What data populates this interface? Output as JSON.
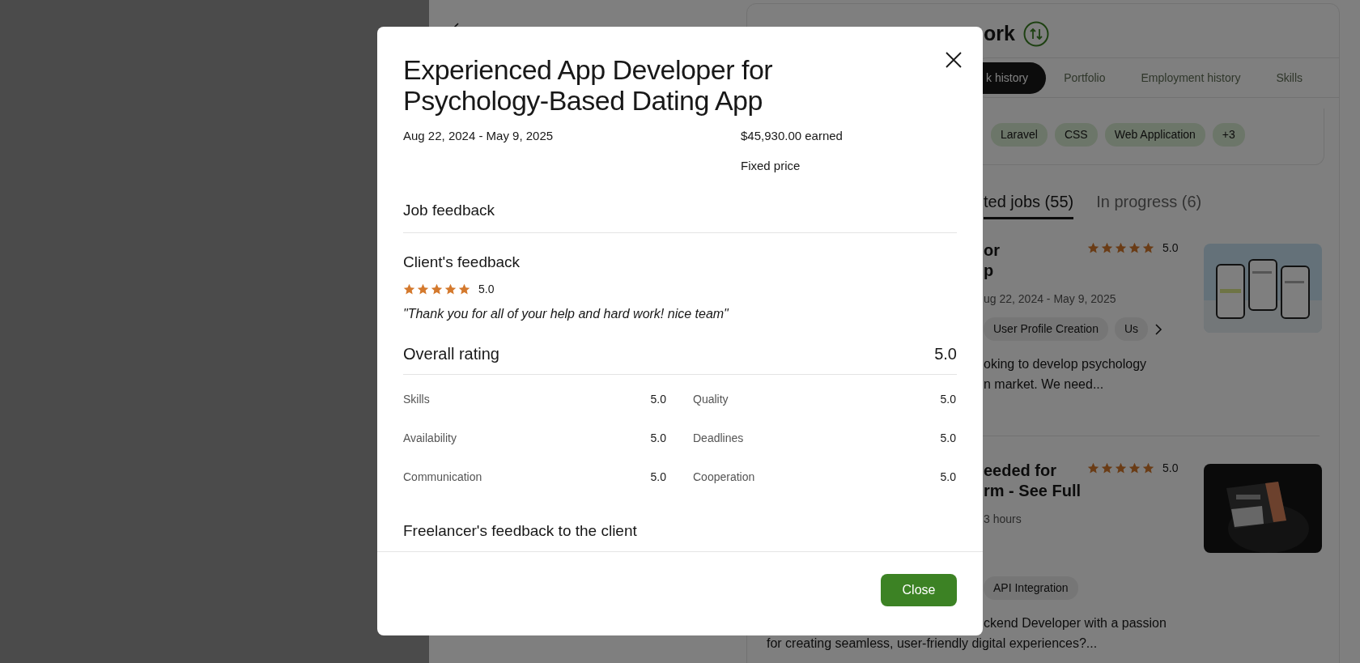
{
  "background_page": {
    "heading": "ork",
    "profile_tabs": [
      {
        "label": "k history",
        "selected": true
      },
      {
        "label": "Portfolio",
        "selected": false
      },
      {
        "label": "Employment history",
        "selected": false
      },
      {
        "label": "Skills",
        "selected": false
      }
    ],
    "skill_tags": [
      "Laravel",
      "CSS",
      "Web Application",
      "+3"
    ],
    "job_tabs": [
      {
        "label": "ted jobs (55)",
        "selected": true
      },
      {
        "label": "In progress (6)",
        "selected": false
      }
    ],
    "jobs": [
      {
        "title_lines": [
          "or",
          "p"
        ],
        "stars": 5,
        "rating": "5.0",
        "meta": "ug 22, 2024 - May 9, 2025",
        "tags": [
          "User Profile Creation",
          "Us"
        ],
        "more_tags": true,
        "description_lines": [
          "oking to develop psychology",
          "n market. We need..."
        ],
        "thumbnail": {
          "kind": "picture"
        }
      },
      {
        "title_lines": [
          "eeded for",
          "rm - See Full"
        ],
        "stars": 5,
        "rating": "5.0",
        "meta": "3 hours",
        "tags": [
          "API Integration"
        ],
        "more_tags": false,
        "description_lines": [
          "ckend Developer with a passion",
          "for creating seamless, user-friendly digital experiences?..."
        ],
        "thumbnail": {
          "kind": "picture"
        }
      }
    ]
  },
  "modal": {
    "title": "Experienced App Developer for Psychology-Based Dating App",
    "dates": "Aug 22, 2024 - May 9, 2025",
    "earned": "$45,930.00 earned",
    "contract_type": "Fixed price",
    "section_title": "Job feedback",
    "client_feedback": {
      "title": "Client's feedback",
      "stars": 5,
      "rating": "5.0",
      "comment": "\"Thank you for all of your help and hard work! nice team\""
    },
    "overall_rating": {
      "label": "Overall rating",
      "value": "5.0"
    },
    "categories": [
      {
        "label": "Skills",
        "value": "5.0"
      },
      {
        "label": "Quality",
        "value": "5.0"
      },
      {
        "label": "Availability",
        "value": "5.0"
      },
      {
        "label": "Deadlines",
        "value": "5.0"
      },
      {
        "label": "Communication",
        "value": "5.0"
      },
      {
        "label": "Cooperation",
        "value": "5.0"
      }
    ],
    "freelancer_feedback_title": "Freelancer's feedback to the client",
    "close_button": "Close"
  }
}
